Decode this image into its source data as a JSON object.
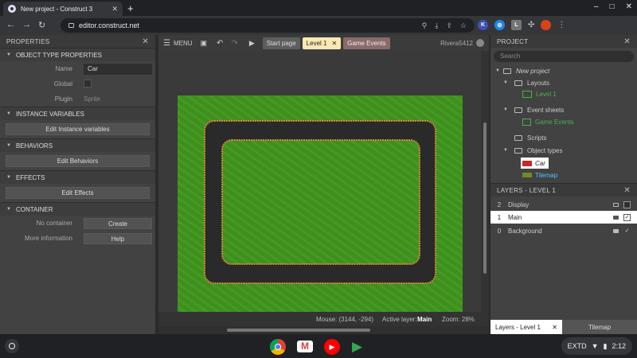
{
  "browser": {
    "tab_title": "New project - Construct 3",
    "tab_close": "✕",
    "new_tab": "+",
    "url": "editor.construct.net",
    "extensions": [
      {
        "name": "k-extension",
        "letter": "K",
        "color": "#3f51b5"
      },
      {
        "name": "blue-extension",
        "letter": "⚙",
        "color": "#1e88e5"
      },
      {
        "name": "l-extension",
        "letter": "L",
        "color": "#757575"
      }
    ],
    "window_controls": [
      "–",
      "□",
      "✕"
    ]
  },
  "properties": {
    "header": "PROPERTIES",
    "sections": {
      "object_type": "OBJECT TYPE PROPERTIES",
      "instance_variables": "INSTANCE VARIABLES",
      "behaviors": "BEHAVIORS",
      "effects": "EFFECTS",
      "container": "CONTAINER"
    },
    "name_label": "Name",
    "name_value": "Car",
    "global_label": "Global",
    "plugin_label": "Plugin",
    "plugin_value": "Sprite",
    "edit_instance_variables": "Edit Instance variables",
    "edit_behaviors": "Edit Behaviors",
    "edit_effects": "Edit Effects",
    "no_container_label": "No container",
    "create_button": "Create",
    "more_info_label": "More information",
    "help_button": "Help"
  },
  "editor": {
    "menu_label": "MENU",
    "tabs": [
      {
        "label": "Start page",
        "active": false
      },
      {
        "label": "Level 1",
        "active": true
      },
      {
        "label": "Game Events",
        "active": false
      }
    ],
    "user": "Rivera5412",
    "status": {
      "mouse": "Mouse: (3144, -294)",
      "active_layer_label": "Active layer:",
      "active_layer_value": "Main",
      "zoom": "Zoom: 28%"
    },
    "colors": {
      "grass": "#3f8f1e",
      "road": "#2a2a2a",
      "road_edge": "#d08a3a"
    }
  },
  "project": {
    "header": "PROJECT",
    "search_placeholder": "Search",
    "root": "New project",
    "layouts_label": "Layouts",
    "layout_item": "Level 1",
    "event_sheets_label": "Event sheets",
    "event_sheet_item": "Game Events",
    "scripts_label": "Scripts",
    "object_types_label": "Object types",
    "object_car": "Car",
    "object_tilemap": "Tilemap"
  },
  "layers": {
    "header": "LAYERS - LEVEL 1",
    "items": [
      {
        "index": "2",
        "name": "Display",
        "visible": false,
        "selected": false
      },
      {
        "index": "1",
        "name": "Main",
        "visible": true,
        "selected": true
      },
      {
        "index": "0",
        "name": "Background",
        "visible": true,
        "selected": false
      }
    ]
  },
  "bottom_tabs": {
    "layers_tab": "Layers - Level 1",
    "tilemap_tab": "Tilemap"
  },
  "tray": {
    "label": "EXTD",
    "time": "2:12"
  }
}
